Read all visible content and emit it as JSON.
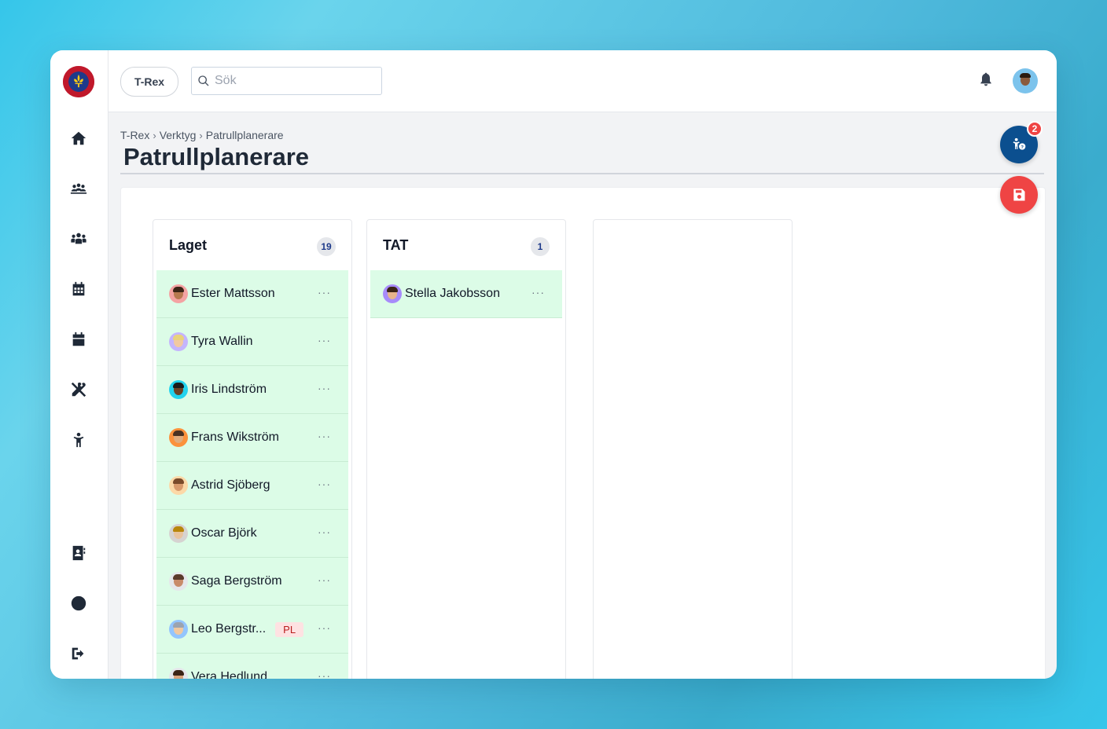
{
  "topbar": {
    "org_label": "T-Rex",
    "search_placeholder": "Sök"
  },
  "breadcrumb": [
    "T-Rex",
    "Verktyg",
    "Patrullplanerare"
  ],
  "page_title": "Patrullplanerare",
  "help_badge": "2",
  "columns": [
    {
      "title": "Laget",
      "count": "19",
      "members": [
        {
          "name": "Ester Mattsson",
          "avatar_bg": "#f4a3a3",
          "skin": "#b7794f",
          "hair": "#3b2416"
        },
        {
          "name": "Tyra Wallin",
          "avatar_bg": "#c4b5fd",
          "skin": "#f2c9a0",
          "hair": "#e9d27a"
        },
        {
          "name": "Iris Lindström",
          "avatar_bg": "#22d3ee",
          "skin": "#6b4226",
          "hair": "#1b1b1b"
        },
        {
          "name": "Frans Wikström",
          "avatar_bg": "#fb923c",
          "skin": "#e0ac7e",
          "hair": "#4a3222"
        },
        {
          "name": "Astrid Sjöberg",
          "avatar_bg": "#fcd9a8",
          "skin": "#d99a6c",
          "hair": "#7a4a2a"
        },
        {
          "name": "Oscar Björk",
          "avatar_bg": "#d6d3d1",
          "skin": "#e8c39e",
          "hair": "#b8860b"
        },
        {
          "name": "Saga Bergström",
          "avatar_bg": "#e5e7eb",
          "skin": "#c88b6a",
          "hair": "#5a3a2a"
        },
        {
          "name": "Leo Bergstr...",
          "tag": "PL",
          "avatar_bg": "#93c5fd",
          "skin": "#f0c8a0",
          "hair": "#9ca3af"
        },
        {
          "name": "Vera Hedlund",
          "avatar_bg": "#e5e7eb",
          "skin": "#d8a37c",
          "hair": "#3b2416"
        }
      ]
    },
    {
      "title": "TAT",
      "count": "1",
      "members": [
        {
          "name": "Stella Jakobsson",
          "avatar_bg": "#a78bfa",
          "skin": "#e7b48c",
          "hair": "#3b2416"
        }
      ]
    }
  ],
  "menu_dots": "···"
}
